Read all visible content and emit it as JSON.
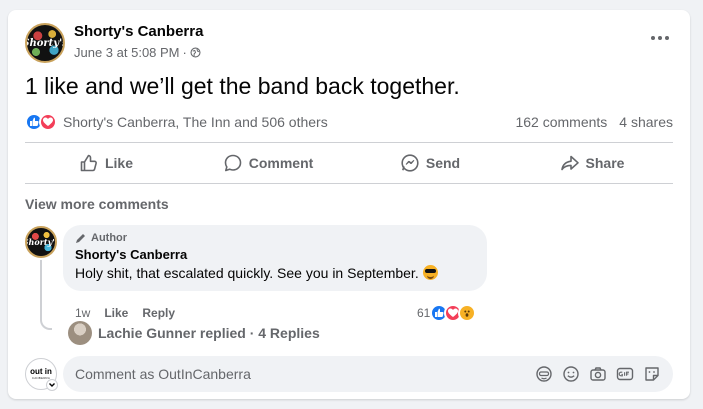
{
  "post": {
    "page_name": "Shorty's Canberra",
    "avatar_text": "Shorty's",
    "date": "June 3 at 5:08 PM",
    "separator": "·",
    "text": "1 like and we’ll get the band back together.",
    "reactions_summary": "Shorty's Canberra, The Inn and 506 others",
    "comments_count": "162 comments",
    "shares_count": "4 shares"
  },
  "actions": {
    "like": "Like",
    "comment": "Comment",
    "send": "Send",
    "share": "Share"
  },
  "comments": {
    "view_more": "View more comments",
    "items": [
      {
        "author_badge": "Author",
        "name": "Shorty's Canberra",
        "text": "Holy shit, that escalated quickly. See you in September.",
        "time": "1w",
        "like": "Like",
        "reply": "Reply",
        "reaction_count": "61",
        "replies_text": "Lachie Gunner replied · 4 Replies"
      }
    ]
  },
  "composer": {
    "avatar_logo": "out in",
    "avatar_sub": "CANBERRA",
    "placeholder": "Comment as OutInCanberra"
  },
  "colors": {
    "like_blue": "#1877f2",
    "love_red": "#f33e58",
    "wow_yellow": "#f7b125",
    "secondary_text": "#65676b"
  },
  "icons": [
    "globe-icon",
    "more-icon",
    "like-icon",
    "comment-icon",
    "send-icon",
    "share-icon",
    "pencil-icon",
    "avatar-icon",
    "sticker-icon",
    "emoji-icon",
    "camera-icon",
    "gif-icon",
    "attach-icon"
  ]
}
